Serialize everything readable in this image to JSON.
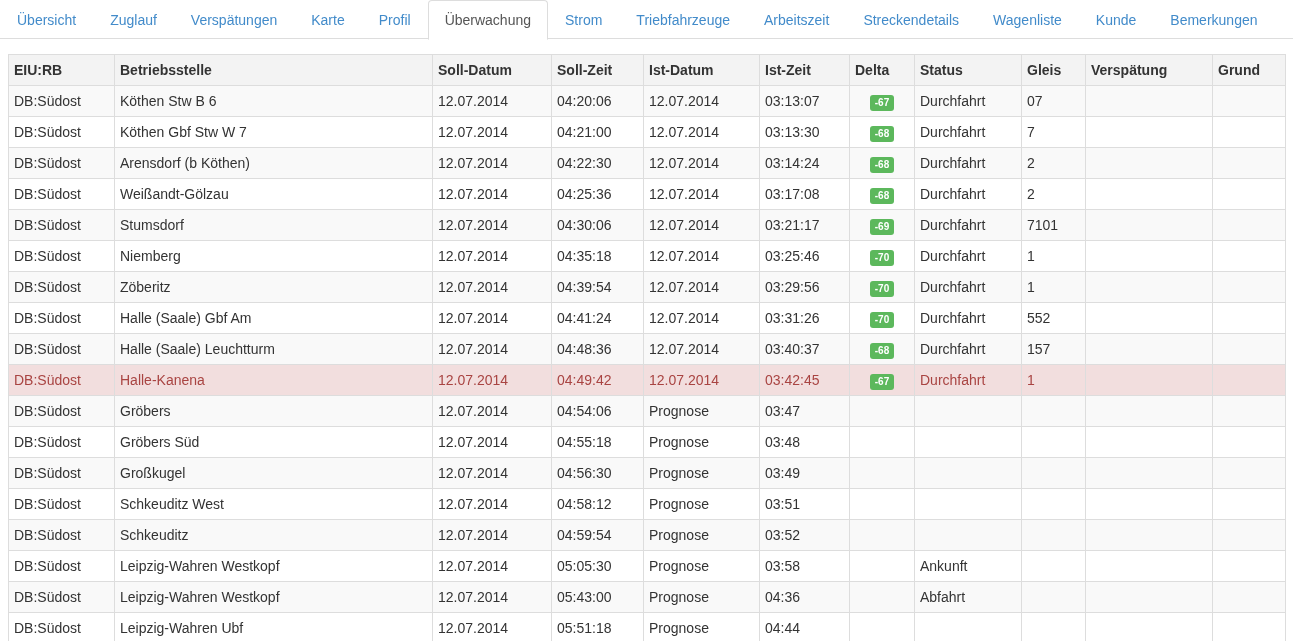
{
  "tabs": [
    {
      "label": "Übersicht",
      "selected": false
    },
    {
      "label": "Zuglauf",
      "selected": false
    },
    {
      "label": "Verspätungen",
      "selected": false
    },
    {
      "label": "Karte",
      "selected": false
    },
    {
      "label": "Profil",
      "selected": false
    },
    {
      "label": "Überwachung",
      "selected": true
    },
    {
      "label": "Strom",
      "selected": false
    },
    {
      "label": "Triebfahrzeuge",
      "selected": false
    },
    {
      "label": "Arbeitszeit",
      "selected": false
    },
    {
      "label": "Streckendetails",
      "selected": false
    },
    {
      "label": "Wagenliste",
      "selected": false
    },
    {
      "label": "Kunde",
      "selected": false
    },
    {
      "label": "Bemerkungen",
      "selected": false
    }
  ],
  "table": {
    "columns": [
      "EIU:RB",
      "Betriebsstelle",
      "Soll-Datum",
      "Soll-Zeit",
      "Ist-Datum",
      "Ist-Zeit",
      "Delta",
      "Status",
      "Gleis",
      "Verspätung",
      "Grund"
    ],
    "rows": [
      {
        "highlighted": false,
        "eiu": "DB:Südost",
        "betriebsstelle": "Köthen Stw B 6",
        "soll_datum": "12.07.2014",
        "soll_zeit": "04:20:06",
        "ist_datum": "12.07.2014",
        "ist_zeit": "03:13:07",
        "delta": "-67",
        "status": "Durchfahrt",
        "gleis": "07"
      },
      {
        "highlighted": false,
        "eiu": "DB:Südost",
        "betriebsstelle": "Köthen Gbf Stw W 7",
        "soll_datum": "12.07.2014",
        "soll_zeit": "04:21:00",
        "ist_datum": "12.07.2014",
        "ist_zeit": "03:13:30",
        "delta": "-68",
        "status": "Durchfahrt",
        "gleis": "7"
      },
      {
        "highlighted": false,
        "eiu": "DB:Südost",
        "betriebsstelle": "Arensdorf (b Köthen)",
        "soll_datum": "12.07.2014",
        "soll_zeit": "04:22:30",
        "ist_datum": "12.07.2014",
        "ist_zeit": "03:14:24",
        "delta": "-68",
        "status": "Durchfahrt",
        "gleis": "2"
      },
      {
        "highlighted": false,
        "eiu": "DB:Südost",
        "betriebsstelle": "Weißandt-Gölzau",
        "soll_datum": "12.07.2014",
        "soll_zeit": "04:25:36",
        "ist_datum": "12.07.2014",
        "ist_zeit": "03:17:08",
        "delta": "-68",
        "status": "Durchfahrt",
        "gleis": "2"
      },
      {
        "highlighted": false,
        "eiu": "DB:Südost",
        "betriebsstelle": "Stumsdorf",
        "soll_datum": "12.07.2014",
        "soll_zeit": "04:30:06",
        "ist_datum": "12.07.2014",
        "ist_zeit": "03:21:17",
        "delta": "-69",
        "status": "Durchfahrt",
        "gleis": "7101"
      },
      {
        "highlighted": false,
        "eiu": "DB:Südost",
        "betriebsstelle": "Niemberg",
        "soll_datum": "12.07.2014",
        "soll_zeit": "04:35:18",
        "ist_datum": "12.07.2014",
        "ist_zeit": "03:25:46",
        "delta": "-70",
        "status": "Durchfahrt",
        "gleis": "1"
      },
      {
        "highlighted": false,
        "eiu": "DB:Südost",
        "betriebsstelle": "Zöberitz",
        "soll_datum": "12.07.2014",
        "soll_zeit": "04:39:54",
        "ist_datum": "12.07.2014",
        "ist_zeit": "03:29:56",
        "delta": "-70",
        "status": "Durchfahrt",
        "gleis": "1"
      },
      {
        "highlighted": false,
        "eiu": "DB:Südost",
        "betriebsstelle": "Halle (Saale) Gbf Am",
        "soll_datum": "12.07.2014",
        "soll_zeit": "04:41:24",
        "ist_datum": "12.07.2014",
        "ist_zeit": "03:31:26",
        "delta": "-70",
        "status": "Durchfahrt",
        "gleis": "552"
      },
      {
        "highlighted": false,
        "eiu": "DB:Südost",
        "betriebsstelle": "Halle (Saale) Leuchtturm",
        "soll_datum": "12.07.2014",
        "soll_zeit": "04:48:36",
        "ist_datum": "12.07.2014",
        "ist_zeit": "03:40:37",
        "delta": "-68",
        "status": "Durchfahrt",
        "gleis": "157"
      },
      {
        "highlighted": true,
        "eiu": "DB:Südost",
        "betriebsstelle": "Halle-Kanena",
        "soll_datum": "12.07.2014",
        "soll_zeit": "04:49:42",
        "ist_datum": "12.07.2014",
        "ist_zeit": "03:42:45",
        "delta": "-67",
        "status": "Durchfahrt",
        "gleis": "1"
      },
      {
        "highlighted": false,
        "eiu": "DB:Südost",
        "betriebsstelle": "Gröbers",
        "soll_datum": "12.07.2014",
        "soll_zeit": "04:54:06",
        "ist_datum": "Prognose",
        "ist_zeit": "03:47"
      },
      {
        "highlighted": false,
        "eiu": "DB:Südost",
        "betriebsstelle": "Gröbers Süd",
        "soll_datum": "12.07.2014",
        "soll_zeit": "04:55:18",
        "ist_datum": "Prognose",
        "ist_zeit": "03:48"
      },
      {
        "highlighted": false,
        "eiu": "DB:Südost",
        "betriebsstelle": "Großkugel",
        "soll_datum": "12.07.2014",
        "soll_zeit": "04:56:30",
        "ist_datum": "Prognose",
        "ist_zeit": "03:49"
      },
      {
        "highlighted": false,
        "eiu": "DB:Südost",
        "betriebsstelle": "Schkeuditz West",
        "soll_datum": "12.07.2014",
        "soll_zeit": "04:58:12",
        "ist_datum": "Prognose",
        "ist_zeit": "03:51"
      },
      {
        "highlighted": false,
        "eiu": "DB:Südost",
        "betriebsstelle": "Schkeuditz",
        "soll_datum": "12.07.2014",
        "soll_zeit": "04:59:54",
        "ist_datum": "Prognose",
        "ist_zeit": "03:52"
      },
      {
        "highlighted": false,
        "eiu": "DB:Südost",
        "betriebsstelle": "Leipzig-Wahren Westkopf",
        "soll_datum": "12.07.2014",
        "soll_zeit": "05:05:30",
        "ist_datum": "Prognose",
        "ist_zeit": "03:58",
        "status": "Ankunft"
      },
      {
        "highlighted": false,
        "eiu": "DB:Südost",
        "betriebsstelle": "Leipzig-Wahren Westkopf",
        "soll_datum": "12.07.2014",
        "soll_zeit": "05:43:00",
        "ist_datum": "Prognose",
        "ist_zeit": "04:36",
        "status": "Abfahrt"
      },
      {
        "highlighted": false,
        "eiu": "DB:Südost",
        "betriebsstelle": "Leipzig-Wahren Ubf",
        "soll_datum": "12.07.2014",
        "soll_zeit": "05:51:18",
        "ist_datum": "Prognose",
        "ist_zeit": "04:44"
      }
    ]
  }
}
